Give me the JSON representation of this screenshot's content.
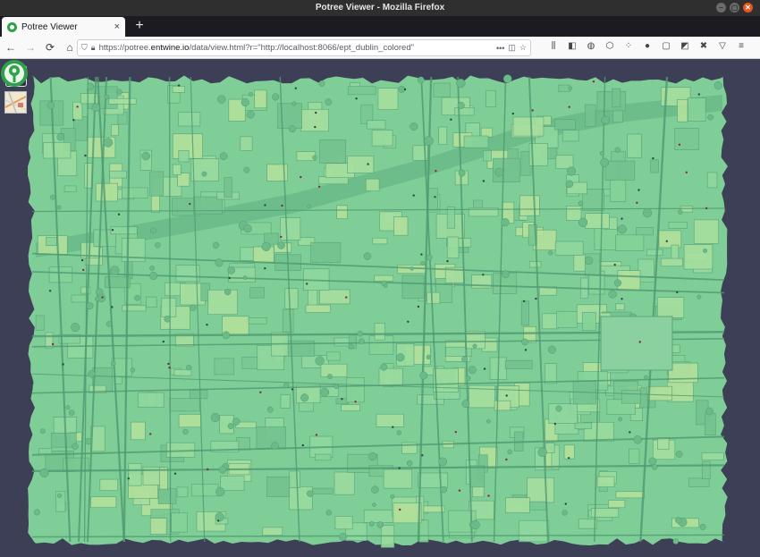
{
  "window": {
    "title": "Potree Viewer - Mozilla Firefox",
    "minimize": "–",
    "maximize": "▢",
    "close": "✕"
  },
  "tab": {
    "title": "Potree Viewer",
    "close": "×",
    "new_tab": "+"
  },
  "navbar": {
    "back": "←",
    "forward": "→",
    "reload": "⟳",
    "home": "⌂",
    "url_prefix": "https://potree.",
    "url_domain": "entwine.io",
    "url_suffix": "/data/view.html?r=\"http://localhost:8066/ept_dublin_colored\"",
    "page_actions": "•••"
  },
  "toolbar": {
    "icons": [
      "library-icon",
      "sidebar-icon",
      "account-icon",
      "extension-icon",
      "extension-icon",
      "profile-icon",
      "extension-icon",
      "screenshot-icon",
      "extension-icon",
      "extension-icon",
      "menu-icon"
    ]
  },
  "viewer": {
    "background": "#3c3f56",
    "pointcloud_color": "#7fce97"
  }
}
